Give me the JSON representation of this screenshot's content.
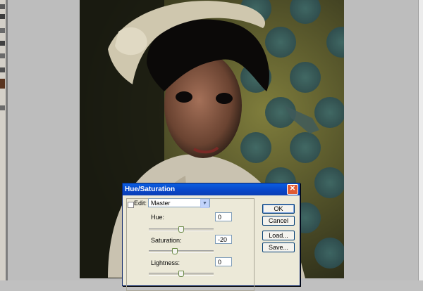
{
  "window": {
    "title": "Hue/Saturation"
  },
  "colors": {
    "title_bar": "#0845c8",
    "close": "#e05a33",
    "dialog_bg": "#ece9d8"
  },
  "dialog": {
    "edit_label": "Edit:",
    "edit_value": "Master",
    "hue": {
      "label": "Hue:",
      "value": "0",
      "level": 0.5
    },
    "saturation": {
      "label": "Saturation:",
      "value": "-20",
      "level": 0.4
    },
    "lightness": {
      "label": "Lightness:",
      "value": "0",
      "level": 0.5
    },
    "buttons": {
      "ok": "OK",
      "cancel": "Cancel",
      "load": "Load...",
      "save": "Save..."
    }
  },
  "icons": {
    "close": "close-icon",
    "dropdown": "chevron-down-icon"
  }
}
